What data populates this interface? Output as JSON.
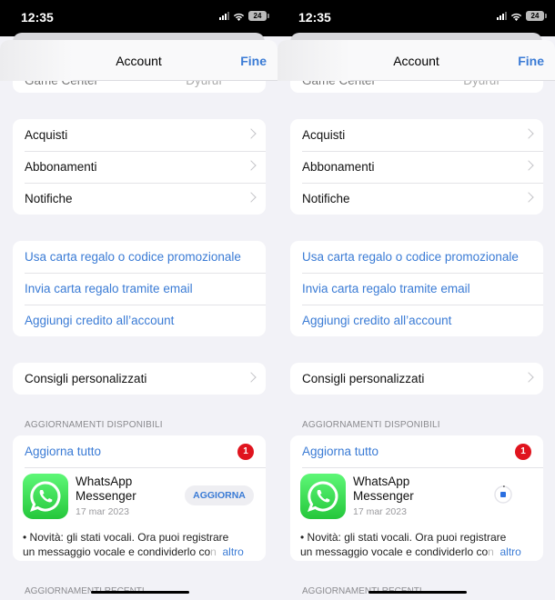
{
  "status_bar": {
    "time": "12:35",
    "battery": "24"
  },
  "screens": [
    {
      "navbar": {
        "title": "Account",
        "done_label": "Fine"
      },
      "hidden_row": {
        "label": "Game Center",
        "value": "Dyuruf"
      },
      "menu_group": [
        {
          "label": "Acquisti"
        },
        {
          "label": "Abbonamenti"
        },
        {
          "label": "Notifiche"
        }
      ],
      "gift_group": [
        {
          "label": "Usa carta regalo o codice promozionale"
        },
        {
          "label": "Invia carta regalo tramite email"
        },
        {
          "label": "Aggiungi credito all’account"
        }
      ],
      "recommendations": {
        "label": "Consigli personalizzati"
      },
      "updates_section": {
        "header": "AGGIORNAMENTI DISPONIBILI",
        "update_all_label": "Aggiorna tutto",
        "badge_count": "1",
        "app": {
          "name": "WhatsApp Messenger",
          "date": "17 mar 2023",
          "button_label": "AGGIORNA",
          "state": "idle",
          "notes_line1": "• Novità: gli stati vocali. Ora puoi registrare",
          "notes_line2": "un messaggio vocale e condividerlo co",
          "notes_fade": "n",
          "more_label": "altro"
        }
      },
      "recent_section": {
        "header": "AGGIORNAMENTI RECENTI"
      }
    },
    {
      "navbar": {
        "title": "Account",
        "done_label": "Fine"
      },
      "hidden_row": {
        "label": "Game Center",
        "value": "Dyuruf"
      },
      "menu_group": [
        {
          "label": "Acquisti"
        },
        {
          "label": "Abbonamenti"
        },
        {
          "label": "Notifiche"
        }
      ],
      "gift_group": [
        {
          "label": "Usa carta regalo o codice promozionale"
        },
        {
          "label": "Invia carta regalo tramite email"
        },
        {
          "label": "Aggiungi credito all’account"
        }
      ],
      "recommendations": {
        "label": "Consigli personalizzati"
      },
      "updates_section": {
        "header": "AGGIORNAMENTI DISPONIBILI",
        "update_all_label": "Aggiorna tutto",
        "badge_count": "1",
        "app": {
          "name": "WhatsApp Messenger",
          "date": "17 mar 2023",
          "state": "downloading",
          "progress": 0.03,
          "notes_line1": "• Novità: gli stati vocali. Ora puoi registrare",
          "notes_line2": "un messaggio vocale e condividerlo co",
          "notes_fade": "n",
          "more_label": "altro"
        }
      },
      "recent_section": {
        "header": "AGGIORNAMENTI RECENTI"
      }
    }
  ],
  "colors": {
    "accent": "#3a7bd5",
    "badge": "#e0141e",
    "background": "#f2f2f7",
    "whatsapp_green": "#25c73b"
  }
}
